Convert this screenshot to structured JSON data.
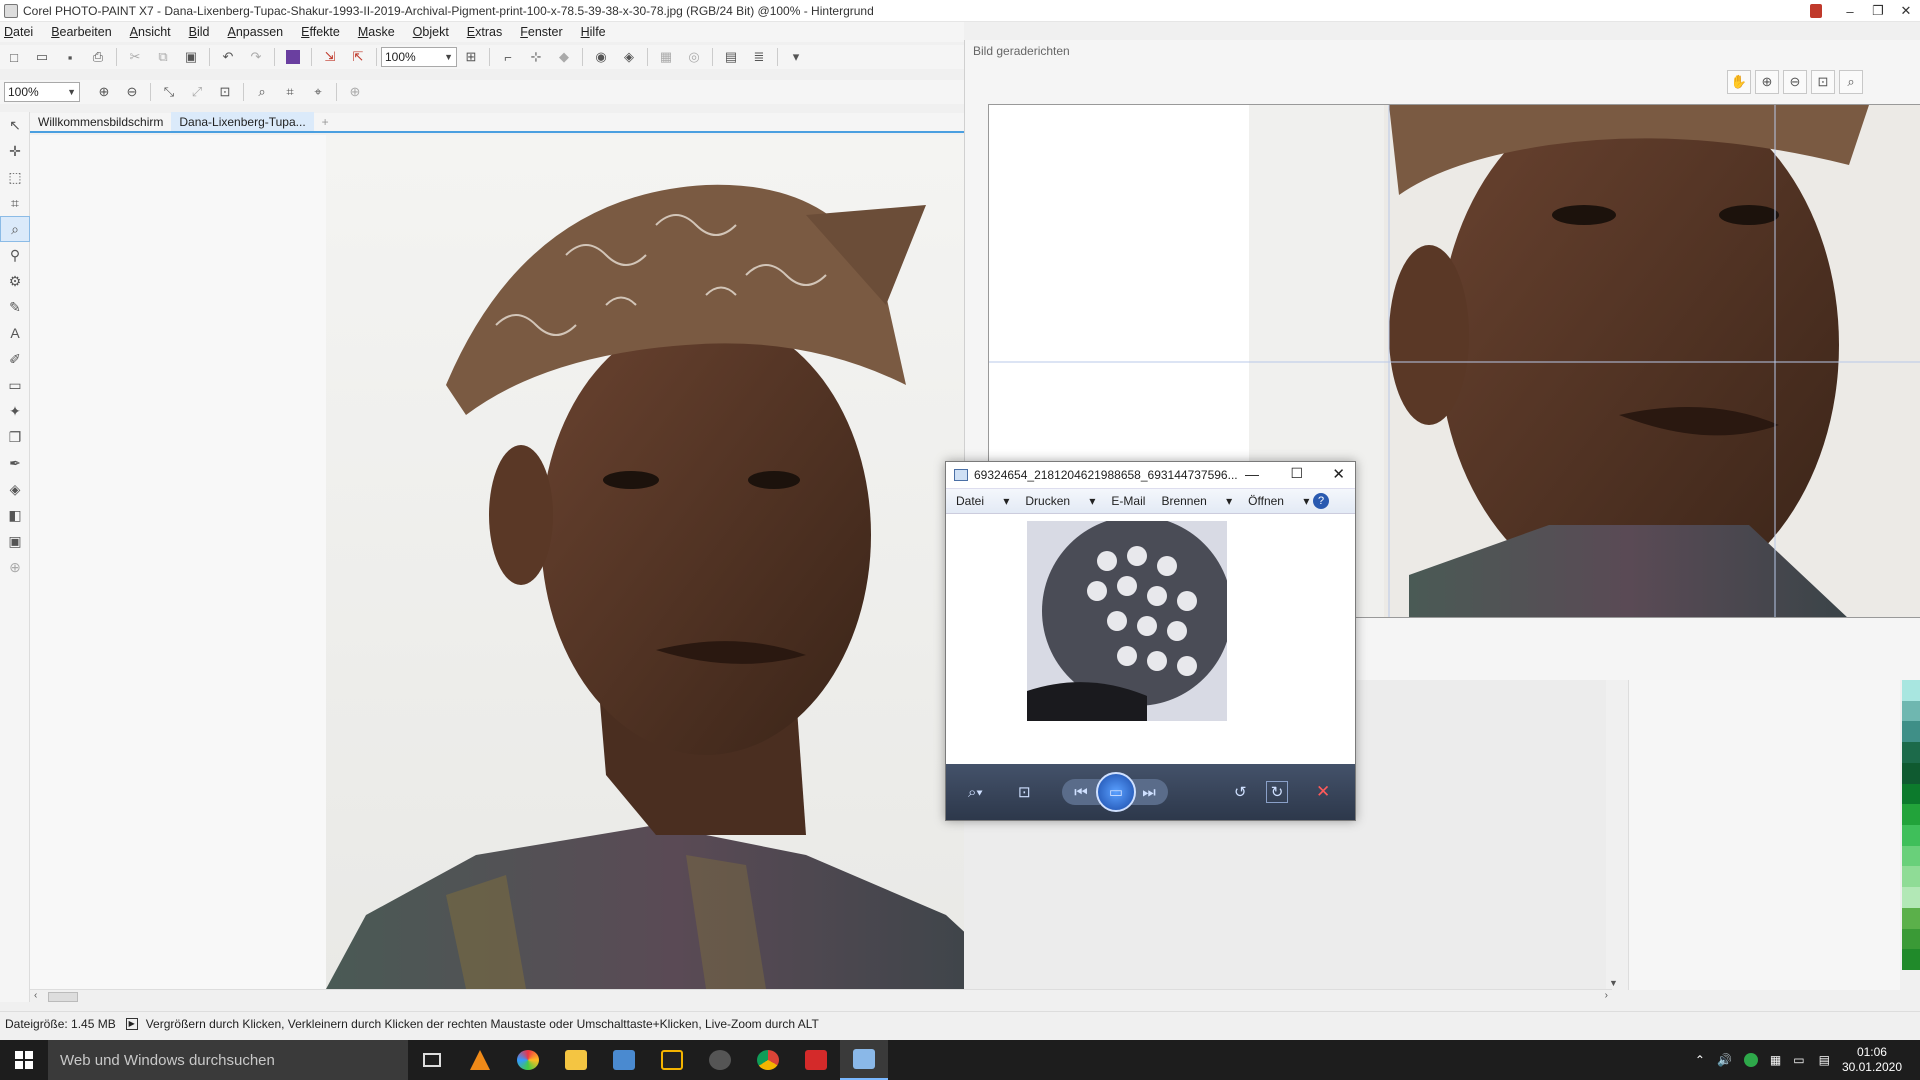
{
  "window": {
    "title": "Corel PHOTO-PAINT X7 - Dana-Lixenberg-Tupac-Shakur-1993-II-2019-Archival-Pigment-print-100-x-78.5-39-38-x-30-78.jpg (RGB/24 Bit) @100% - Hintergrund",
    "minimize": "–",
    "maximize": "❐",
    "close": "✕"
  },
  "menu": [
    "Datei",
    "Bearbeiten",
    "Ansicht",
    "Bild",
    "Anpassen",
    "Effekte",
    "Maske",
    "Objekt",
    "Extras",
    "Fenster",
    "Hilfe"
  ],
  "toolbar": {
    "zoom_value": "100%"
  },
  "toolbar2": {
    "zoom_value": "100%"
  },
  "tabs": [
    {
      "label": "Willkommensbildschirm",
      "active": false
    },
    {
      "label": "Dana-Lixenberg-Tupa...",
      "active": true
    }
  ],
  "tab_add": "+",
  "straighten": {
    "title": "Bild geraderichten"
  },
  "viewer": {
    "title": "69324654_2181204621988658_693144737596...",
    "menu": [
      "Datei",
      "Drucken",
      "E-Mail",
      "Brennen",
      "Öffnen"
    ],
    "help": "?"
  },
  "status": {
    "file_size": "Dateigröße: 1.45 MB",
    "hint": "Vergrößern durch Klicken, Verkleinern durch Klicken der rechten Maustaste oder Umschalttaste+Klicken, Live-Zoom durch ALT"
  },
  "taskbar": {
    "search_placeholder": "Web und Windows durchsuchen",
    "time": "01:06",
    "date": "30.01.2020"
  },
  "colors": {
    "accent": "#4a9fe0",
    "palette": [
      "#a8e6e0",
      "#6fb7b0",
      "#3f8f87",
      "#1c6a4a",
      "#0f5a30",
      "#0c7a2c",
      "#22a33a",
      "#3fbf5a",
      "#69d07a",
      "#8fdc96",
      "#b2e8b6",
      "#5bb04a",
      "#3a9a36",
      "#208a2a"
    ]
  }
}
